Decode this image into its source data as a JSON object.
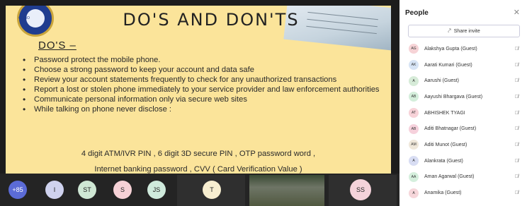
{
  "slide": {
    "logo_text": "CRIBO",
    "title": "DO'S AND DON'TS",
    "subtitle": "DO'S –",
    "bullets": [
      "Password protect the mobile phone.",
      "Choose a strong password to keep your account and data safe",
      "Review your account statements frequently to check for any unauthorized transactions",
      "Report a lost or stolen phone immediately to your service provider and law enforcement authorities",
      "Communicate personal information only via secure web sites",
      "While talking on phone never disclose :"
    ],
    "line_pins": "4 digit ATM/IVR PIN ,  6 digit 3D secure PIN ,  OTP password word ,",
    "line_banking": "Internet banking password ,  CVV ( Card Verification Value )"
  },
  "strip": {
    "more_count": "+85",
    "avatars": [
      "I",
      "ST",
      "S",
      "JS",
      "T",
      "SS"
    ],
    "avatar_colors": [
      "#cfd2ee",
      "#cfe7d4",
      "#f6d1d6",
      "#cfeadc",
      "#f7eed0",
      "#f4d2da"
    ]
  },
  "people_panel": {
    "title": "People",
    "close_icon": "close-icon",
    "share_label": "Share invite",
    "participants": [
      {
        "initials": "AG",
        "name": "Alakshya Gupta (Guest)",
        "color": "#f6d3d6"
      },
      {
        "initials": "AK",
        "name": "Aarati Kumari (Guest)",
        "color": "#d7e4f5"
      },
      {
        "initials": "A",
        "name": "Aarushi (Guest)",
        "color": "#d6ebd8"
      },
      {
        "initials": "AB",
        "name": "Aayushi Bhargava (Guest)",
        "color": "#d4eedb"
      },
      {
        "initials": "AT",
        "name": "ABHISHEK TYAGI",
        "color": "#f7d2d8"
      },
      {
        "initials": "AB",
        "name": "Aditi Bhatnagar (Guest)",
        "color": "#f6d1dc"
      },
      {
        "initials": "AM",
        "name": "Aditi Munot (Guest)",
        "color": "#efe7da"
      },
      {
        "initials": "A",
        "name": "Alankrata (Guest)",
        "color": "#d8ddf3"
      },
      {
        "initials": "AA",
        "name": "Aman Agarwal (Guest)",
        "color": "#d5efdd"
      },
      {
        "initials": "A",
        "name": "Anamika (Guest)",
        "color": "#f6d6da"
      }
    ]
  }
}
